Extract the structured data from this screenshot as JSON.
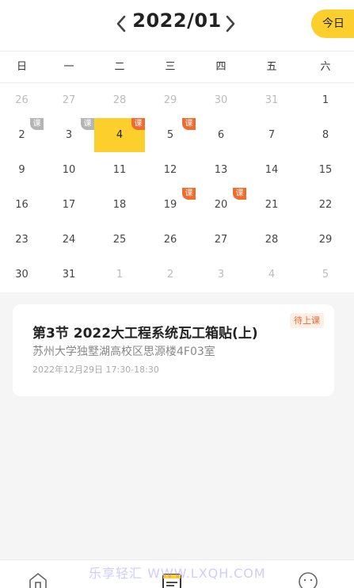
{
  "header": {
    "title": "2022/01",
    "today_label": "今日"
  },
  "weekdays": [
    "日",
    "一",
    "二",
    "三",
    "四",
    "五",
    "六"
  ],
  "weeks": [
    [
      {
        "d": "26",
        "other": true
      },
      {
        "d": "27",
        "other": true
      },
      {
        "d": "28",
        "other": true
      },
      {
        "d": "29",
        "other": true
      },
      {
        "d": "30",
        "other": true
      },
      {
        "d": "31",
        "other": true
      },
      {
        "d": "1"
      }
    ],
    [
      {
        "d": "2",
        "badge": "课",
        "badge_color": "gray"
      },
      {
        "d": "3",
        "badge": "课",
        "badge_color": "gray"
      },
      {
        "d": "4",
        "badge": "课",
        "badge_color": "orange",
        "selected": true
      },
      {
        "d": "5",
        "badge": "课",
        "badge_color": "orange"
      },
      {
        "d": "6"
      },
      {
        "d": "7"
      },
      {
        "d": "8"
      }
    ],
    [
      {
        "d": "9"
      },
      {
        "d": "10"
      },
      {
        "d": "11"
      },
      {
        "d": "12"
      },
      {
        "d": "13"
      },
      {
        "d": "14"
      },
      {
        "d": "15"
      }
    ],
    [
      {
        "d": "16"
      },
      {
        "d": "17"
      },
      {
        "d": "18"
      },
      {
        "d": "19",
        "badge": "课",
        "badge_color": "orange"
      },
      {
        "d": "20",
        "badge": "课",
        "badge_color": "orange"
      },
      {
        "d": "21"
      },
      {
        "d": "22"
      }
    ],
    [
      {
        "d": "23"
      },
      {
        "d": "24"
      },
      {
        "d": "25"
      },
      {
        "d": "26"
      },
      {
        "d": "27"
      },
      {
        "d": "28"
      },
      {
        "d": "29"
      }
    ],
    [
      {
        "d": "30"
      },
      {
        "d": "31"
      },
      {
        "d": "1",
        "other": true
      },
      {
        "d": "2",
        "other": true
      },
      {
        "d": "3",
        "other": true
      },
      {
        "d": "4",
        "other": true
      },
      {
        "d": "5",
        "other": true
      }
    ]
  ],
  "course_card": {
    "title": "第3节 2022大工程系统瓦工箱贴(上)",
    "place": "苏州大学独墅湖高校区思源楼4F03室",
    "time": "2022年12月29日  17:30-18:30",
    "status": "待上课"
  },
  "watermark": "乐享轻汇 WWW.LXQH.COM",
  "colors": {
    "accent": "#fccf2c",
    "badge_orange": "#ef6b2e",
    "badge_gray": "#b5b5b5"
  }
}
